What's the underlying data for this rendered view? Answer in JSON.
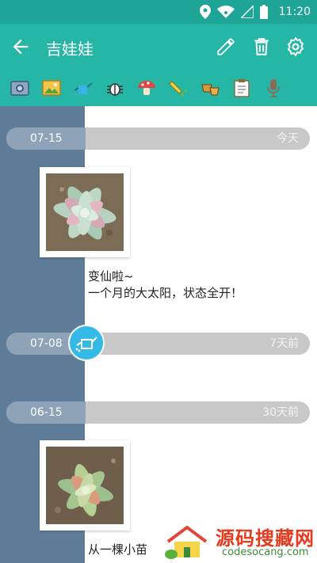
{
  "statusbar": {
    "time": "11:20"
  },
  "toolbar": {
    "title": "吉娃娃"
  },
  "entries": [
    {
      "date": "07-15",
      "relative": "今天",
      "note_line1": "变仙啦~",
      "note_line2": "一个月的大太阳，状态全开！"
    },
    {
      "date": "07-08",
      "relative": "7天前"
    },
    {
      "date": "06-15",
      "relative": "30天前",
      "note_line1": "从一棵小苗"
    }
  ],
  "watermark": {
    "cn": "源码搜藏网",
    "en": "codesocang.com"
  },
  "colors": {
    "primary": "#26b6a6",
    "primary_dark": "#1fa597",
    "timeline": "#5f7d98",
    "water": "#35b9e6"
  }
}
